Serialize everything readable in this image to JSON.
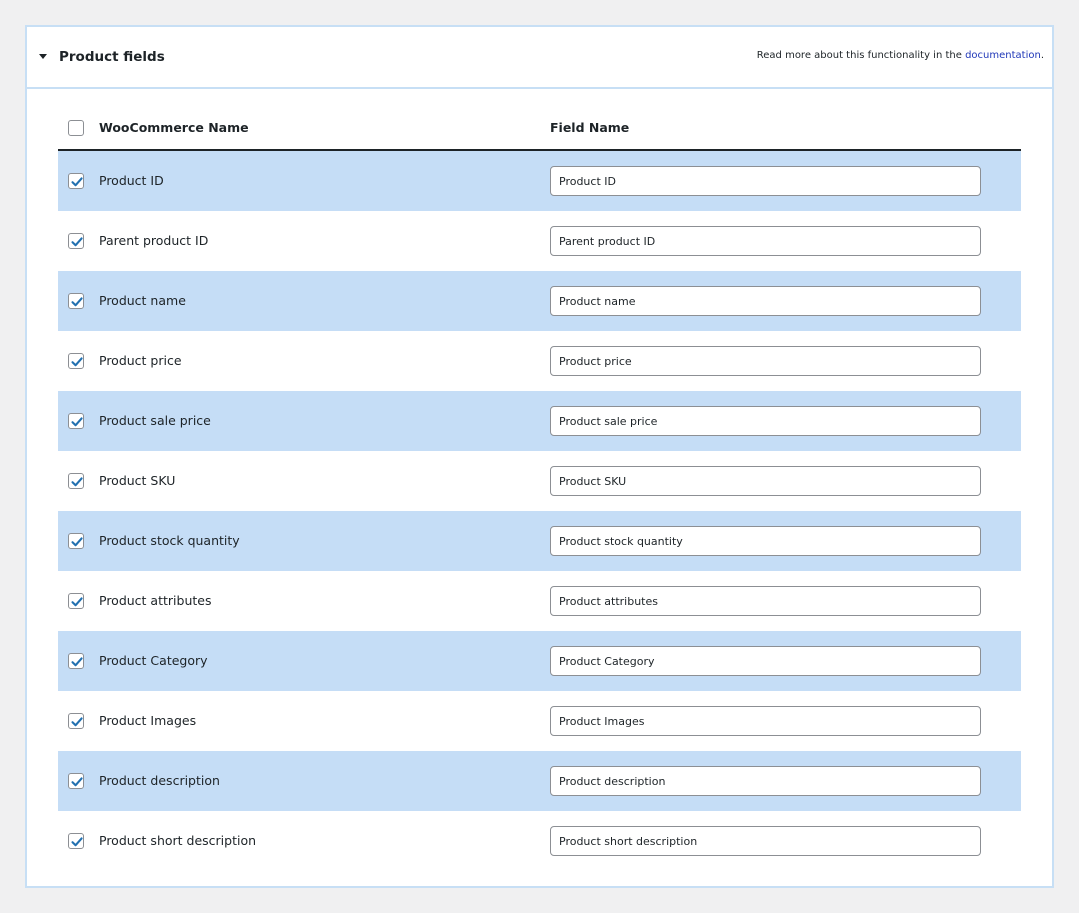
{
  "panel": {
    "title": "Product fields",
    "doc_text": "Read more about this functionality in the",
    "doc_link": "documentation",
    "doc_suffix": "."
  },
  "table": {
    "header": {
      "name_label": "WooCommerce Name",
      "field_label": "Field Name",
      "select_all_checked": false
    },
    "rows": [
      {
        "name": "Product ID",
        "value": "Product ID",
        "checked": true
      },
      {
        "name": "Parent product ID",
        "value": "Parent product ID",
        "checked": true
      },
      {
        "name": "Product name",
        "value": "Product name",
        "checked": true
      },
      {
        "name": "Product price",
        "value": "Product price",
        "checked": true
      },
      {
        "name": "Product sale price",
        "value": "Product sale price",
        "checked": true
      },
      {
        "name": "Product SKU",
        "value": "Product SKU",
        "checked": true
      },
      {
        "name": "Product stock quantity",
        "value": "Product stock quantity",
        "checked": true
      },
      {
        "name": "Product attributes",
        "value": "Product attributes",
        "checked": true
      },
      {
        "name": "Product Category",
        "value": "Product Category",
        "checked": true
      },
      {
        "name": "Product Images",
        "value": "Product Images",
        "checked": true
      },
      {
        "name": "Product description",
        "value": "Product description",
        "checked": true
      },
      {
        "name": "Product short description",
        "value": "Product short description",
        "checked": true
      }
    ]
  },
  "colors": {
    "alt_row": "#c5ddf6",
    "check": "#2271b1",
    "link": "#2038b8"
  }
}
